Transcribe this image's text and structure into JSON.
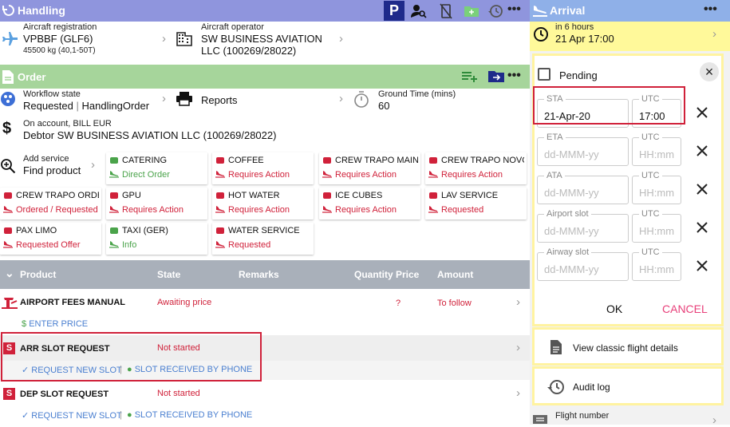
{
  "handling": {
    "title": "Handling",
    "aircraft_registration_label": "Aircraft registration",
    "aircraft_registration": "VPBBF (GLF6)",
    "aircraft_weight": "45500 kg (40,1-50T)",
    "aircraft_operator_label": "Aircraft operator",
    "aircraft_operator_line1": "SW BUSINESS AVIATION",
    "aircraft_operator_line2": "LLC (100269/28022)"
  },
  "order": {
    "title": "Order",
    "workflow_label": "Workflow state",
    "workflow_state": "Requested",
    "workflow_sep": "|",
    "workflow_type": "HandlingOrder",
    "reports_label": "Reports",
    "ground_time_label": "Ground Time (mins)",
    "ground_time": "60",
    "account_label": "On account, BILL EUR",
    "debtor": "Debtor SW BUSINESS AVIATION LLC (100269/28022)",
    "add_service_label": "Add service",
    "find_product": "Find product"
  },
  "services": [
    {
      "name": "CATERING",
      "status": "Direct Order",
      "color": "green"
    },
    {
      "name": "COFFEE",
      "status": "Requires Action",
      "color": "red"
    },
    {
      "name": "CREW TRAPO MAIN ...",
      "status": "Requires Action",
      "color": "red"
    },
    {
      "name": "CREW TRAPO NOVO...",
      "status": "Requires Action",
      "color": "red"
    },
    {
      "name": "CREW TRAPO ORDER",
      "status": "Ordered / Requested",
      "color": "red"
    },
    {
      "name": "GPU",
      "status": "Requires Action",
      "color": "red"
    },
    {
      "name": "HOT WATER",
      "status": "Requires Action",
      "color": "red"
    },
    {
      "name": "ICE CUBES",
      "status": "Requires Action",
      "color": "red"
    },
    {
      "name": "LAV SERVICE",
      "status": "Requested",
      "color": "red"
    },
    {
      "name": "PAX LIMO",
      "status": "Requested Offer",
      "color": "red"
    },
    {
      "name": "TAXI (GER)",
      "status": "Info",
      "color": "green"
    },
    {
      "name": "WATER SERVICE",
      "status": "Requested",
      "color": "red"
    }
  ],
  "table": {
    "headers": {
      "product": "Product",
      "state": "State",
      "remarks": "Remarks",
      "quantity": "Quantity",
      "price": "Price",
      "amount": "Amount"
    },
    "rows": [
      {
        "name": "AIRPORT FEES MANUAL",
        "state": "Awaiting price",
        "price": "?",
        "amount": "To follow",
        "action": "ENTER PRICE"
      },
      {
        "name": "ARR SLOT REQUEST",
        "state": "Not started",
        "action1": "REQUEST NEW SLOT",
        "action2": "SLOT RECEIVED BY PHONE",
        "sep": "|"
      },
      {
        "name": "DEP SLOT REQUEST",
        "state": "Not started",
        "action1": "REQUEST NEW SLOT",
        "action2": "SLOT RECEIVED BY PHONE",
        "sep": "|"
      }
    ]
  },
  "arrival": {
    "title": "Arrival",
    "eta_relative": "in 6 hours",
    "eta_date": "21 Apr 17:00",
    "pending_label": "Pending",
    "fields": [
      {
        "label": "STA",
        "date": "21-Apr-20",
        "utc_label": "UTC",
        "time": "17:00"
      },
      {
        "label": "ETA",
        "date": "dd-MMM-yy",
        "utc_label": "UTC",
        "time": "HH:mm"
      },
      {
        "label": "ATA",
        "date": "dd-MMM-yy",
        "utc_label": "UTC",
        "time": "HH:mm"
      },
      {
        "label": "Airport slot",
        "date": "dd-MMM-yy",
        "utc_label": "UTC",
        "time": "HH:mm"
      },
      {
        "label": "Airway slot",
        "date": "dd-MMM-yy",
        "utc_label": "UTC",
        "time": "HH:mm"
      }
    ],
    "ok_label": "OK",
    "cancel_label": "CANCEL",
    "classic_details": "View classic flight details",
    "audit_log": "Audit log",
    "flight_number_label": "Flight number"
  },
  "colors": {
    "handling_bar": "#8f95dd",
    "order_bar": "#a6d59b",
    "arrival_bar": "#8fb0e8",
    "accent_red": "#d0213a",
    "cancel_pink": "#e8407a"
  }
}
